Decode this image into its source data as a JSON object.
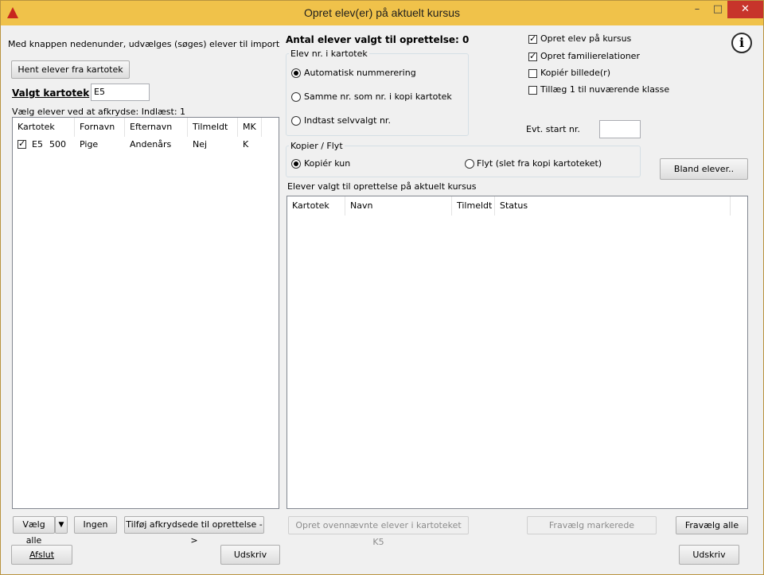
{
  "window": {
    "title": "Opret elev(er) på aktuelt kursus",
    "min_glyph": "–",
    "max_glyph": "□",
    "close_glyph": "✕"
  },
  "left": {
    "intro_text": "Med knappen nedenunder, udvælges (søges) elever til import",
    "fetch_button": "Hent elever fra kartotek",
    "chosen_label": "Valgt kartotek",
    "chosen_value": "E5",
    "select_hint": "Vælg elever ved at afkrydse: Indlæst: 1",
    "table": {
      "headers": [
        "Kartotek",
        "Fornavn",
        "Efternavn",
        "Tilmeldt",
        "MK"
      ],
      "rows": [
        {
          "checked": true,
          "kartotek": "E5",
          "nr": "500",
          "fornavn": "Pige",
          "efternavn": "Andenårs",
          "tilmeldt": "Nej",
          "mk": "K"
        }
      ]
    },
    "select_all_button": "Vælg alle",
    "dropdown_glyph": "▼",
    "none_button": "Ingen",
    "add_button": "Tilføj afkrydsede til oprettelse ->",
    "exit_button": "Afslut",
    "print_button": "Udskriv"
  },
  "right": {
    "count_label": "Antal elever valgt til oprettelse: 0",
    "numbering_group": {
      "title": "Elev nr. i kartotek",
      "options": [
        "Automatisk nummerering",
        "Samme nr. som nr. i kopi kartotek",
        "Indtast selvvalgt nr."
      ],
      "selected_index": 0
    },
    "checkboxes": [
      {
        "label": "Opret elev på kursus",
        "checked": true
      },
      {
        "label": "Opret familierelationer",
        "checked": true
      },
      {
        "label": "Kopiér billede(r)",
        "checked": false
      },
      {
        "label": "Tillæg 1 til nuværende klasse",
        "checked": false
      }
    ],
    "start_nr_label": "Evt. start nr.",
    "start_nr_value": "",
    "copy_group": {
      "title": "Kopier / Flyt",
      "options": [
        "Kopiér kun",
        "Flyt (slet fra kopi kartoteket)"
      ],
      "selected_index": 0
    },
    "shuffle_button": "Bland elever..",
    "selected_caption": "Elever valgt til oprettelse på aktuelt kursus",
    "table": {
      "headers": [
        "Kartotek",
        "Navn",
        "Tilmeldt",
        "Status"
      ],
      "rows": []
    },
    "create_button": "Opret ovennævnte elever i kartoteket K5",
    "deselect_marked_button": "Fravælg markerede",
    "deselect_all_button": "Fravælg alle",
    "print_button": "Udskriv"
  },
  "info_glyph": "i"
}
